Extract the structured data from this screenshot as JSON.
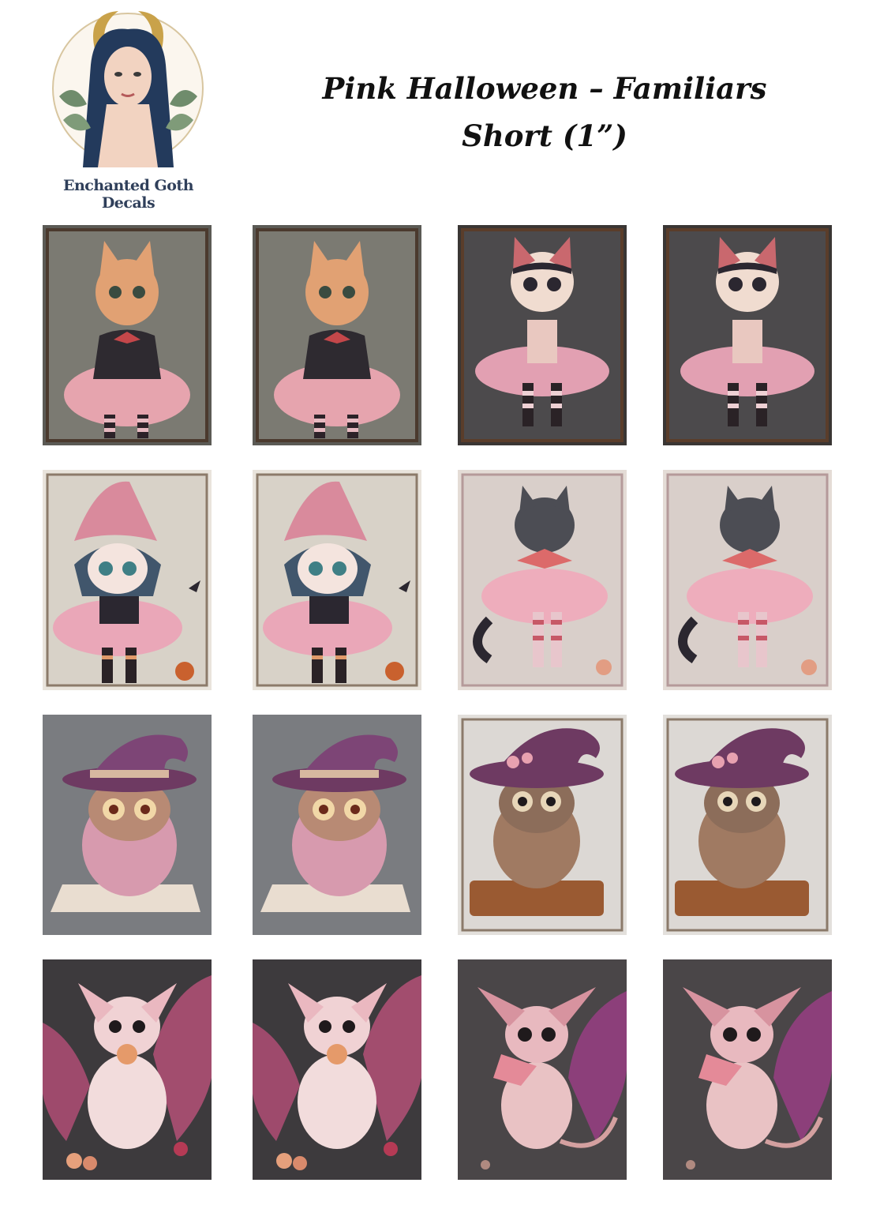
{
  "brand": {
    "name": "Enchanted Goth Decals"
  },
  "title": {
    "line1": "Pink Halloween – Familiars",
    "line2": "Short (1”)"
  },
  "colors": {
    "pink": "#e9a5b3",
    "dark": "#2b2730",
    "purple": "#6e3a62",
    "cream": "#efe6dc"
  },
  "sheet": {
    "rows": [
      {
        "subject": "kitten-ballerina",
        "variants": [
          "orange-kitten-icon",
          "orange-kitten-icon",
          "black-cat-icon",
          "black-cat-icon"
        ]
      },
      {
        "subject": "witch-kitten",
        "variants": [
          "witch-kitten-icon",
          "witch-kitten-icon",
          "grey-cat-icon",
          "grey-cat-icon"
        ]
      },
      {
        "subject": "witch-owl",
        "variants": [
          "owl-on-grimoire-icon",
          "owl-on-grimoire-icon",
          "owl-on-book-icon",
          "owl-on-book-icon"
        ]
      },
      {
        "subject": "bat-creature",
        "variants": [
          "bat-creature-icon",
          "bat-creature-icon",
          "bat-creature-eating-icon",
          "bat-creature-eating-icon"
        ]
      }
    ]
  }
}
